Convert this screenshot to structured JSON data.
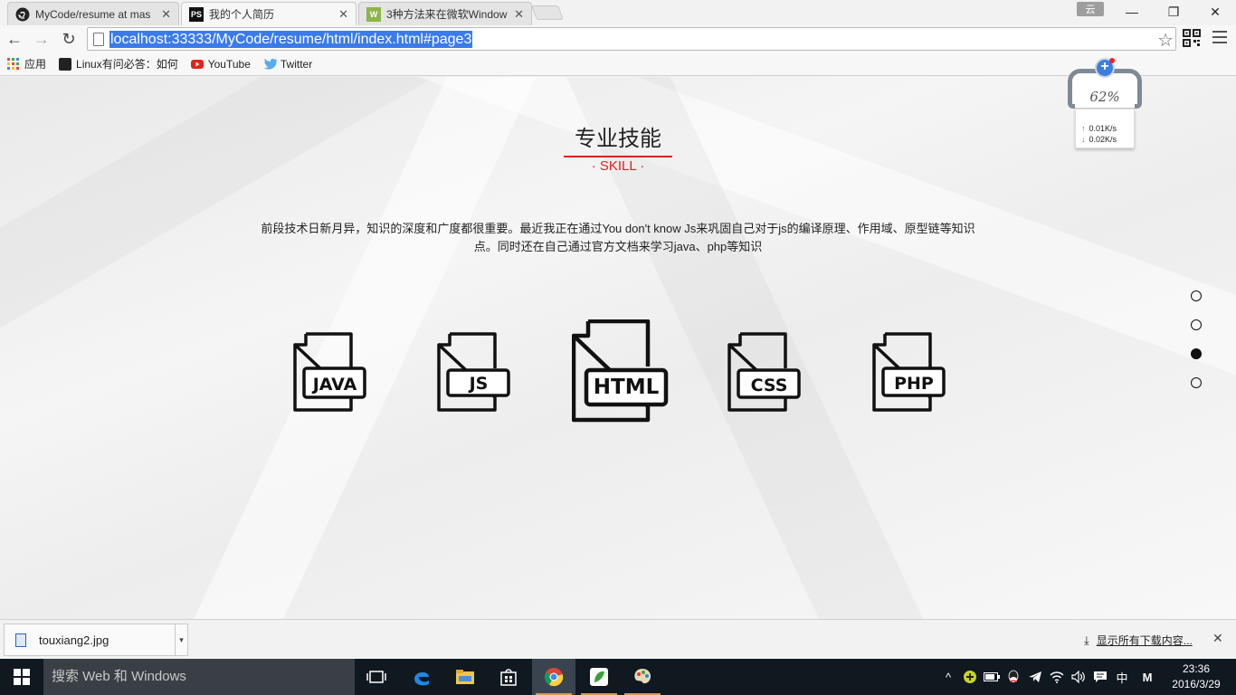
{
  "browser": {
    "tabs": [
      {
        "title": "MyCode/resume at mas",
        "icon": "github-icon"
      },
      {
        "title": "我的个人简历",
        "icon": "phpstorm-icon"
      },
      {
        "title": "3种方法来在微软Window",
        "icon": "wikihow-icon"
      }
    ],
    "user_badge": "云",
    "url": "localhost:33333/MyCode/resume/html/index.html#page3",
    "bookmarks": [
      {
        "label": "应用",
        "icon": "apps-grid-icon"
      },
      {
        "label": "Linux有问必答：如何",
        "icon": "linux-icon"
      },
      {
        "label": "YouTube",
        "icon": "youtube-icon"
      },
      {
        "label": "Twitter",
        "icon": "twitter-icon"
      }
    ]
  },
  "page": {
    "heading": "专业技能",
    "subheading": "· SKILL ·",
    "description": "前段技术日新月异，知识的深度和广度都很重要。最近我正在通过You don't know Js来巩固自己对于js的编译原理、作用域、原型链等知识点。同时还在自己通过官方文档来学习java、php等知识",
    "skills": [
      "JAVA",
      "JS",
      "HTML",
      "CSS",
      "PHP"
    ],
    "page_dots": {
      "count": 4,
      "active_index": 2
    }
  },
  "speed_widget": {
    "percent": "62%",
    "upload": "0.01K/s",
    "download": "0.02K/s"
  },
  "download_bar": {
    "file": "touxiang2.jpg",
    "show_all": "显示所有下载内容..."
  },
  "taskbar": {
    "search_placeholder": "搜索 Web 和 Windows",
    "ime_lang": "中",
    "ime_mode": "M",
    "time": "23:36",
    "date": "2016/3/29"
  },
  "colors": {
    "accent_red": "#e02020",
    "url_highlight": "#3b7be9",
    "taskbar": "#101820"
  }
}
